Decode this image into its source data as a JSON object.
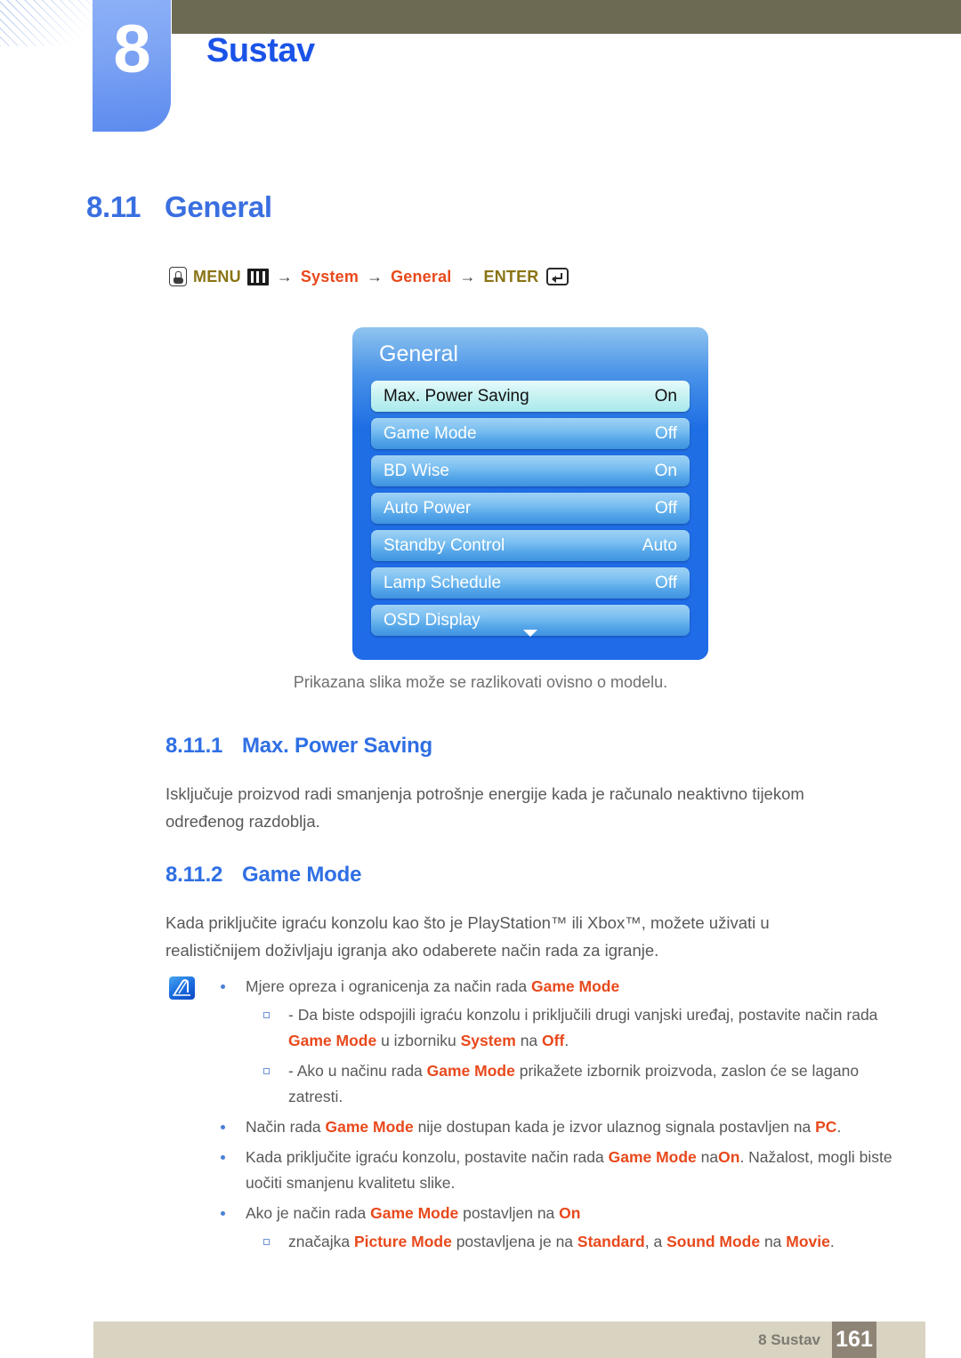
{
  "header": {
    "chapter_number": "8",
    "chapter_title": "Sustav",
    "accent_blue": "#1a53e8",
    "topbar_color": "#6d6a53",
    "tab_color": "#6d97f2"
  },
  "section": {
    "number": "8.11",
    "title": "General"
  },
  "menu_path": {
    "hand_icon": "hand-press-icon",
    "menu_label": "MENU",
    "grid_icon": "menu-grid-icon",
    "arrow": "→",
    "step_system": "System",
    "step_general": "General",
    "enter_label": "ENTER",
    "enter_icon": "enter-key-icon",
    "olive_color": "#8a7415",
    "red_color": "#e8491c"
  },
  "osd": {
    "title": "General",
    "rows": [
      {
        "label": "Max. Power Saving",
        "value": "On",
        "selected": true
      },
      {
        "label": "Game Mode",
        "value": "Off",
        "selected": false
      },
      {
        "label": "BD Wise",
        "value": "On",
        "selected": false
      },
      {
        "label": "Auto Power",
        "value": "Off",
        "selected": false
      },
      {
        "label": "Standby Control",
        "value": "Auto",
        "selected": false
      },
      {
        "label": "Lamp Schedule",
        "value": "Off",
        "selected": false
      },
      {
        "label": "OSD Display",
        "value": "",
        "selected": false
      }
    ],
    "scroll_icon": "chevron-down-icon",
    "caption": "Prikazana slika može se razlikovati ovisno o modelu."
  },
  "subsections": [
    {
      "number": "8.11.1",
      "title": "Max. Power Saving",
      "paragraph": "Isključuje proizvod radi smanjenja potrošnje energije kada je računalo neaktivno tijekom određenog razdoblja."
    },
    {
      "number": "8.11.2",
      "title": "Game Mode",
      "paragraph": "Kada priključite igraću konzolu kao što je PlayStation™ ili Xbox™, možete uživati u realističnijem doživljaju igranja ako odaberete način rada za igranje."
    }
  ],
  "note": {
    "icon": "note-pen-icon",
    "items": [
      {
        "text_parts": [
          {
            "t": "Mjere opreza i ogranicenja za način rada ",
            "kw": false
          },
          {
            "t": "Game Mode",
            "kw": true
          }
        ],
        "sub": [
          {
            "text_parts": [
              {
                "t": "- Da biste odspojili igraću konzolu i priključili drugi vanjski uređaj, postavite način rada ",
                "kw": false
              },
              {
                "t": "Game Mode",
                "kw": true
              },
              {
                "t": " u izborniku ",
                "kw": false
              },
              {
                "t": "System",
                "kw": true
              },
              {
                "t": " na ",
                "kw": false
              },
              {
                "t": "Off",
                "kw": true
              },
              {
                "t": ".",
                "kw": false
              }
            ]
          },
          {
            "text_parts": [
              {
                "t": "- Ako u načinu rada ",
                "kw": false
              },
              {
                "t": "Game Mode",
                "kw": true
              },
              {
                "t": " prikažete izbornik proizvoda, zaslon će se lagano zatresti.",
                "kw": false
              }
            ]
          }
        ]
      },
      {
        "text_parts": [
          {
            "t": "Način rada ",
            "kw": false
          },
          {
            "t": "Game Mode",
            "kw": true
          },
          {
            "t": " nije dostupan kada je izvor ulaznog signala postavljen na ",
            "kw": false
          },
          {
            "t": "PC",
            "kw": true
          },
          {
            "t": ".",
            "kw": false
          }
        ],
        "sub": []
      },
      {
        "text_parts": [
          {
            "t": "Kada priključite igraću konzolu, postavite način rada ",
            "kw": false
          },
          {
            "t": "Game Mode",
            "kw": true
          },
          {
            "t": " na",
            "kw": false
          },
          {
            "t": "On",
            "kw": true
          },
          {
            "t": ". Nažalost, mogli biste uočiti smanjenu kvalitetu slike.",
            "kw": false
          }
        ],
        "sub": []
      },
      {
        "text_parts": [
          {
            "t": "Ako je način rada ",
            "kw": false
          },
          {
            "t": "Game Mode",
            "kw": true
          },
          {
            "t": " postavljen na ",
            "kw": false
          },
          {
            "t": "On",
            "kw": true
          }
        ],
        "sub": [
          {
            "text_parts": [
              {
                "t": "značajka ",
                "kw": false
              },
              {
                "t": "Picture Mode",
                "kw": true
              },
              {
                "t": " postavljena je na ",
                "kw": false
              },
              {
                "t": "Standard",
                "kw": true
              },
              {
                "t": ", a ",
                "kw": false
              },
              {
                "t": "Sound Mode",
                "kw": true
              },
              {
                "t": " na ",
                "kw": false
              },
              {
                "t": "Movie",
                "kw": true
              },
              {
                "t": ".",
                "kw": false
              }
            ]
          }
        ]
      }
    ]
  },
  "footer": {
    "label": "8 Sustav",
    "page_number": "161",
    "bar_color": "#d9d3c1",
    "page_box_color": "#8e8476"
  }
}
